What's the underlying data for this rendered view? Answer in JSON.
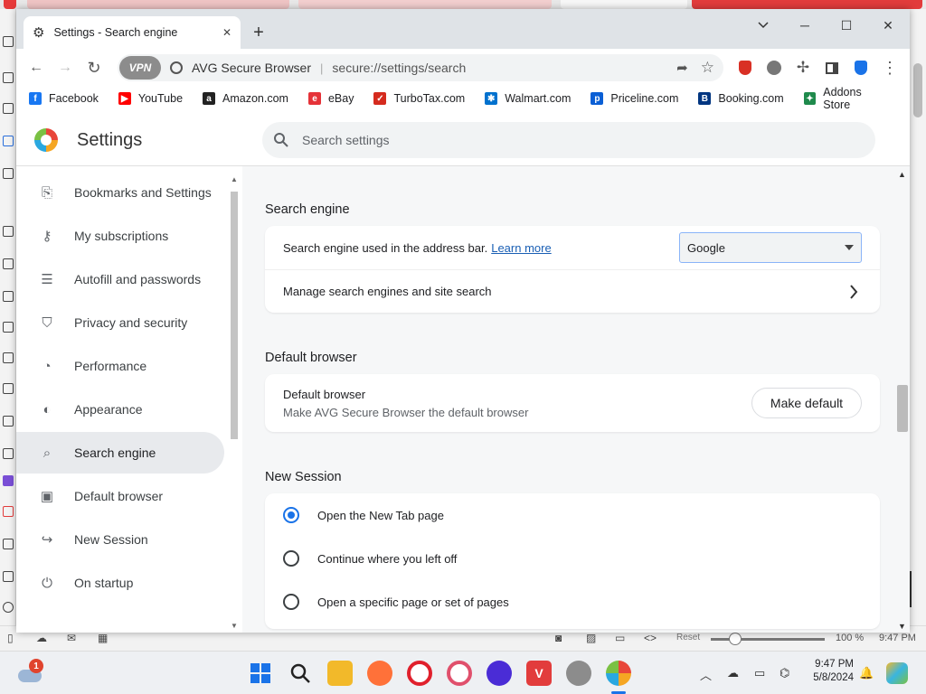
{
  "window": {
    "tab_title": "Settings - Search engine",
    "controls": {
      "minimize": "chevron-down",
      "min": "─",
      "max": "☐",
      "close": "✕"
    }
  },
  "toolbar": {
    "vpn_label": "VPN",
    "brand": "AVG Secure Browser",
    "url": "secure://settings/search"
  },
  "bookmarks": [
    {
      "label": "Facebook",
      "color": "#1877f2",
      "glyph": "f"
    },
    {
      "label": "YouTube",
      "color": "#ff0000",
      "glyph": "▶"
    },
    {
      "label": "Amazon.com",
      "color": "#222222",
      "glyph": "a"
    },
    {
      "label": "eBay",
      "color": "#e53238",
      "glyph": "e"
    },
    {
      "label": "TurboTax.com",
      "color": "#d52b1e",
      "glyph": "✓"
    },
    {
      "label": "Walmart.com",
      "color": "#0071ce",
      "glyph": "✱"
    },
    {
      "label": "Priceline.com",
      "color": "#0a5fd5",
      "glyph": "p"
    },
    {
      "label": "Booking.com",
      "color": "#003580",
      "glyph": "B"
    },
    {
      "label": "Addons Store",
      "color": "#1f8a4c",
      "glyph": "✦"
    }
  ],
  "settings": {
    "title": "Settings",
    "search_placeholder": "Search settings"
  },
  "sidebar": [
    {
      "label": "Bookmarks and Settings",
      "icon": "bookmark-import-icon",
      "glyph": "⎘"
    },
    {
      "label": "My subscriptions",
      "icon": "key-icon",
      "glyph": "⚷"
    },
    {
      "label": "Autofill and passwords",
      "icon": "list-icon",
      "glyph": "☰"
    },
    {
      "label": "Privacy and security",
      "icon": "shield-icon",
      "glyph": "⛉"
    },
    {
      "label": "Performance",
      "icon": "speedometer-icon",
      "glyph": "◔"
    },
    {
      "label": "Appearance",
      "icon": "palette-icon",
      "glyph": "◐"
    },
    {
      "label": "Search engine",
      "icon": "search-icon",
      "glyph": "⌕",
      "active": true
    },
    {
      "label": "Default browser",
      "icon": "browser-icon",
      "glyph": "▣"
    },
    {
      "label": "New Session",
      "icon": "new-session-icon",
      "glyph": "↪"
    },
    {
      "label": "On startup",
      "icon": "power-icon",
      "glyph": "⏻"
    }
  ],
  "content": {
    "search_engine": {
      "heading": "Search engine",
      "row1_text": "Search engine used in the address bar.",
      "learn_more": "Learn more",
      "selected": "Google",
      "row2_text": "Manage search engines and site search"
    },
    "default_browser": {
      "heading": "Default browser",
      "title": "Default browser",
      "subtitle": "Make AVG Secure Browser the default browser",
      "button": "Make default"
    },
    "new_session": {
      "heading": "New Session",
      "options": [
        {
          "label": "Open the New Tab page",
          "selected": true
        },
        {
          "label": "Continue where you left off",
          "selected": false
        },
        {
          "label": "Open a specific page or set of pages",
          "selected": false
        }
      ]
    }
  },
  "background_app": {
    "reset_label": "Reset",
    "zoom": "100 %",
    "time": "9:47 PM"
  },
  "taskbar": {
    "time": "9:47 PM",
    "date": "5/8/2024",
    "notification_count": "1"
  }
}
